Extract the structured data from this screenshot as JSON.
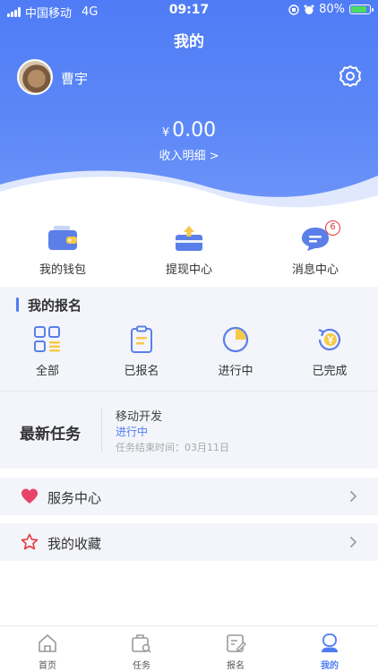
{
  "status_bar": {
    "carrier": "中国移动",
    "network": "4G",
    "time": "09:17",
    "battery": "80%"
  },
  "header": {
    "title": "我的",
    "username": "曹宇",
    "balance_currency": "¥",
    "balance_amount": "0.00",
    "income_link": "收入明细 >"
  },
  "quick_actions": [
    {
      "label": "我的钱包",
      "icon": "wallet-icon"
    },
    {
      "label": "提现中心",
      "icon": "withdraw-icon"
    },
    {
      "label": "消息中心",
      "icon": "message-icon",
      "badge": "6"
    }
  ],
  "registration": {
    "title": "我的报名",
    "items": [
      {
        "label": "全部",
        "icon": "grid-list-icon"
      },
      {
        "label": "已报名",
        "icon": "clipboard-icon"
      },
      {
        "label": "进行中",
        "icon": "pie-progress-icon"
      },
      {
        "label": "已完成",
        "icon": "yen-refresh-icon"
      }
    ]
  },
  "latest_task": {
    "heading": "最新任务",
    "name": "移动开发",
    "status": "进行中",
    "end_time": "任务结束时间：03月11日"
  },
  "menu": [
    {
      "label": "服务中心",
      "icon": "heart-icon"
    },
    {
      "label": "我的收藏",
      "icon": "star-icon"
    }
  ],
  "tabbar": [
    {
      "label": "首页",
      "icon": "home-icon"
    },
    {
      "label": "任务",
      "icon": "task-icon"
    },
    {
      "label": "报名",
      "icon": "signup-icon"
    },
    {
      "label": "我的",
      "icon": "profile-icon",
      "active": true
    }
  ],
  "colors": {
    "primary": "#4f7cf6",
    "accent_yellow": "#f7c948",
    "accent_red": "#e5393f",
    "badge_red": "#e5393f"
  }
}
